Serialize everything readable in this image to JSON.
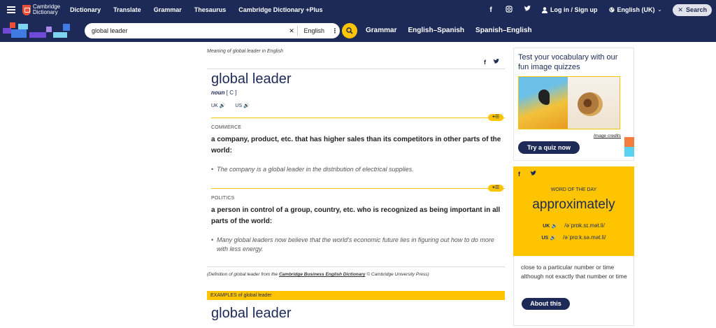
{
  "topbar": {
    "logo_line1": "Cambridge",
    "logo_line2": "Dictionary",
    "links": [
      "Dictionary",
      "Translate",
      "Grammar",
      "Thesaurus",
      "Cambridge Dictionary +Plus"
    ],
    "login": "Log in / Sign up",
    "language": "English (UK)",
    "search": "Search"
  },
  "subbar": {
    "search_value": "global leader",
    "dict_lang": "English",
    "links": [
      "Grammar",
      "English–Spanish",
      "Spanish–English"
    ]
  },
  "entry": {
    "meaning_of": "Meaning of global leader in English",
    "headword": "global leader",
    "pos": "noun",
    "grammar": "[ C ]",
    "uk": "UK",
    "us": "US",
    "senses": [
      {
        "domain": "COMMERCE",
        "definition": "a company, product, etc. that has higher sales than its competitors in other parts of the world:",
        "example": "The company is a global leader in the distribution of electrical supplies."
      },
      {
        "domain": "POLITICS",
        "definition": "a person in control of a group, country, etc. who is recognized as being important in all parts of the world:",
        "example": "Many global leaders now believe that the world's economic future lies in figuring out how to do more with less energy."
      }
    ],
    "credit_prefix": "(Definition of global leader from the ",
    "credit_source": "Cambridge Business English Dictionary",
    "credit_suffix": " © Cambridge University Press)",
    "examples_label": "EXAMPLES of global leader",
    "headword2": "global leader"
  },
  "quiz": {
    "title": "Test your vocabulary with our fun image quizzes",
    "image_credits": "Image credits",
    "button": "Try a quiz now"
  },
  "wotd": {
    "label": "WORD OF THE DAY",
    "word": "approximately",
    "uk": "UK",
    "uk_ipa": "/əˈprɒk.sɪ.mət.li/",
    "us": "US",
    "us_ipa": "/əˈprɑːk.sə.mət.li/",
    "definition": "close to a particular number or time although not exactly that number or time",
    "button": "About this"
  },
  "colors": {
    "navy": "#1d2a57",
    "yellow": "#fec400",
    "red": "#e8503a"
  }
}
